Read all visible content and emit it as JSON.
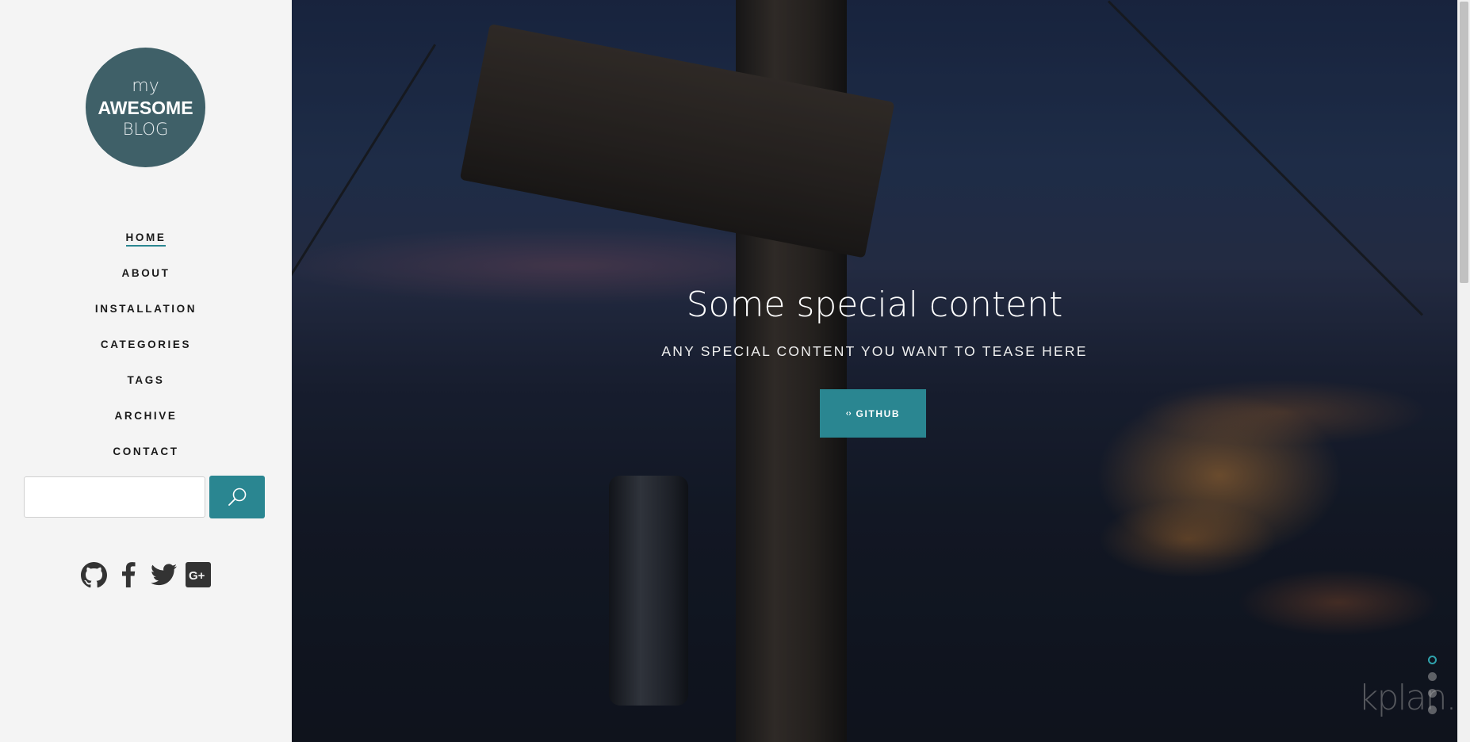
{
  "logo": {
    "line1": "my",
    "line2": "AWESOME",
    "line3": "BLOG"
  },
  "nav": [
    {
      "label": "HOME",
      "active": true
    },
    {
      "label": "ABOUT",
      "active": false
    },
    {
      "label": "INSTALLATION",
      "active": false
    },
    {
      "label": "CATEGORIES",
      "active": false
    },
    {
      "label": "TAGS",
      "active": false
    },
    {
      "label": "ARCHIVE",
      "active": false
    },
    {
      "label": "CONTACT",
      "active": false
    }
  ],
  "search": {
    "value": "",
    "button_icon": "search-icon"
  },
  "social": [
    "github-icon",
    "facebook-icon",
    "twitter-icon",
    "google-plus-icon"
  ],
  "hero": {
    "title": "Some special content",
    "subtitle": "ANY SPECIAL CONTENT YOU WANT TO TEASE HERE",
    "button_label": "GITHUB",
    "button_icon": "code-icon",
    "watermark": "kplan.ch"
  },
  "slider": {
    "count": 4,
    "active": 1
  },
  "colors": {
    "accent": "#2a8691",
    "logo_bg": "#3f6068",
    "sidebar_bg": "#f4f4f4"
  }
}
